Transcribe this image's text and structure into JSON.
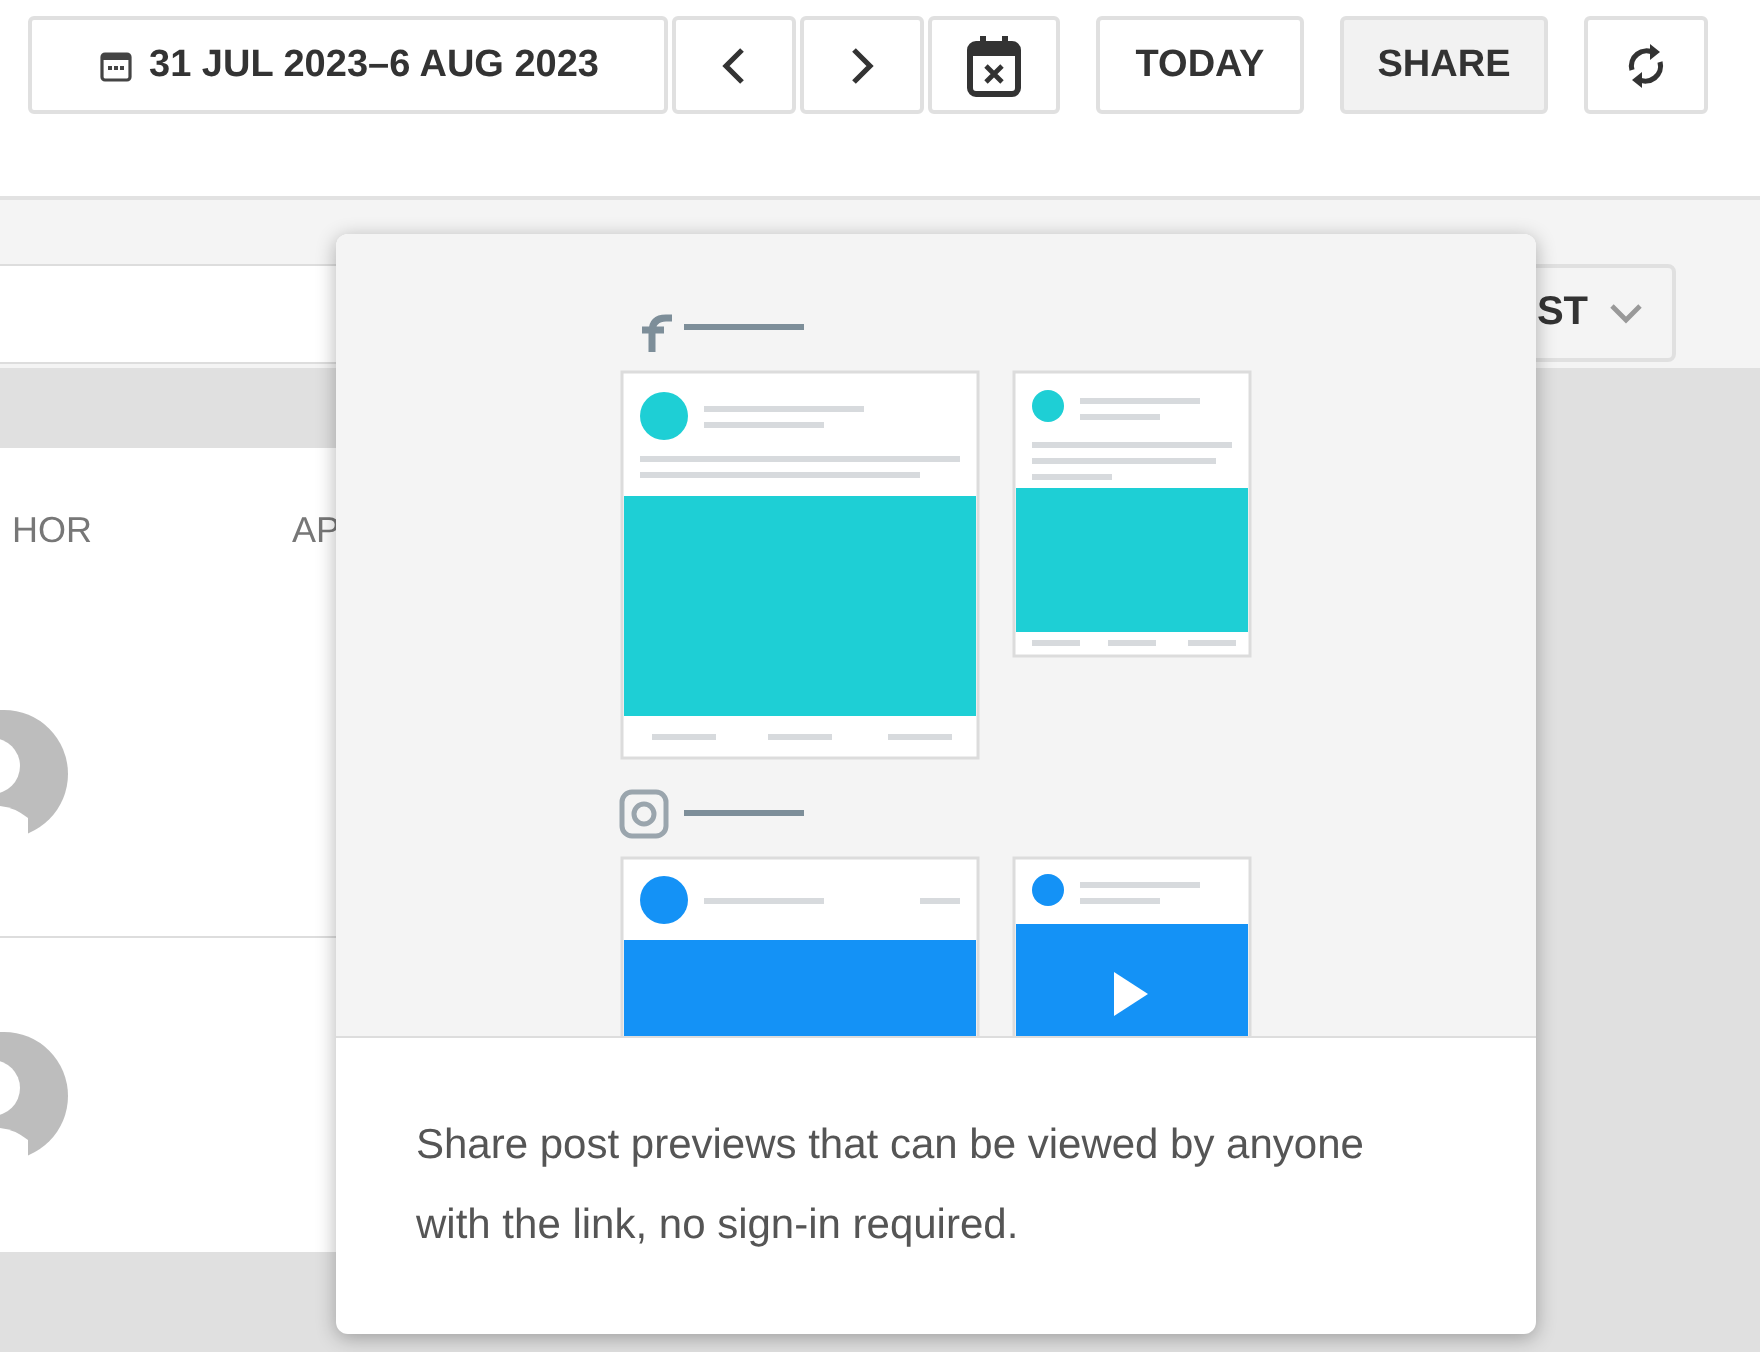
{
  "toolbar": {
    "date_range": "31 JUL 2023–6 AUG 2023",
    "today": "TODAY",
    "share": {
      "label": "SHARE",
      "active": true
    }
  },
  "filters": {
    "dropdown": "ST"
  },
  "table": {
    "columns": [
      "HOR",
      "AP"
    ],
    "rows": [
      {
        "kind": "avatar"
      },
      {
        "kind": "avatar"
      }
    ]
  },
  "popover": {
    "description": "Share post previews that can be viewed by anyone with the link, no sign-in required."
  }
}
